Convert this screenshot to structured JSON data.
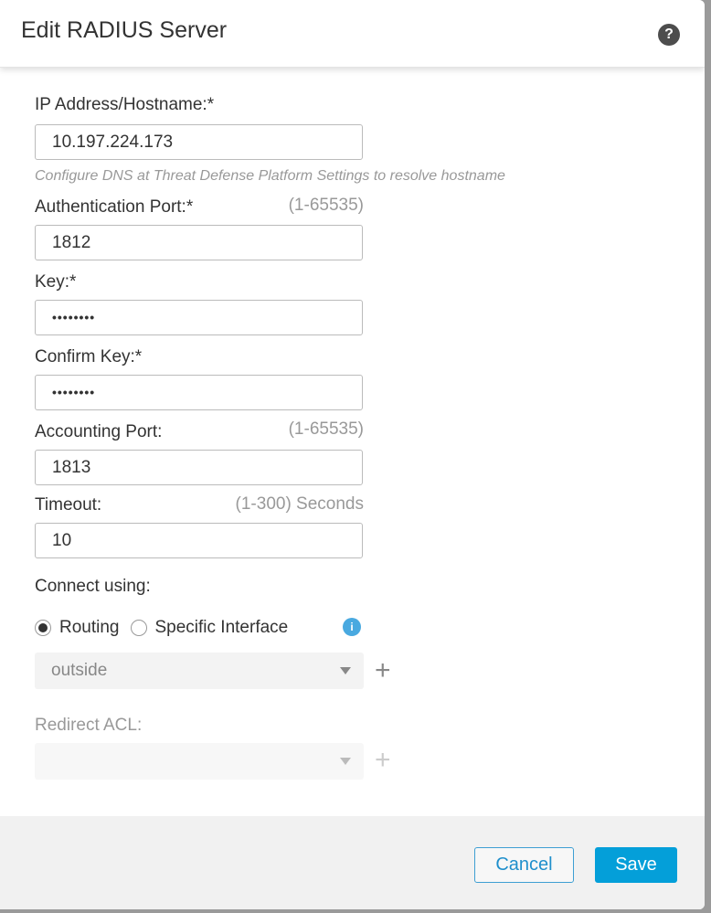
{
  "dialog": {
    "title": "Edit RADIUS Server",
    "help_icon": "?"
  },
  "fields": {
    "ip": {
      "label": "IP Address/Hostname:*",
      "value": "10.197.224.173",
      "note": "Configure DNS at Threat Defense Platform Settings to resolve hostname"
    },
    "auth_port": {
      "label": "Authentication Port:*",
      "hint": "(1-65535)",
      "value": "1812"
    },
    "key": {
      "label": "Key:*",
      "value": "••••••••"
    },
    "confirm_key": {
      "label": "Confirm Key:*",
      "value": "••••••••"
    },
    "acct_port": {
      "label": "Accounting Port:",
      "hint": "(1-65535)",
      "value": "1813"
    },
    "timeout": {
      "label": "Timeout:",
      "hint": "(1-300) Seconds",
      "value": "10"
    }
  },
  "connect": {
    "label": "Connect using:",
    "options": [
      {
        "label": "Routing",
        "selected": true
      },
      {
        "label": "Specific Interface",
        "selected": false
      }
    ],
    "info_icon": "i",
    "interface_select": {
      "value": "outside"
    },
    "add_symbol": "+"
  },
  "redirect_acl": {
    "label": "Redirect ACL:",
    "value": "",
    "add_symbol": "+"
  },
  "footer": {
    "cancel_label": "Cancel",
    "save_label": "Save"
  },
  "colors": {
    "primary": "#049fd9",
    "info": "#49a9e0",
    "hint_text": "#999999"
  }
}
